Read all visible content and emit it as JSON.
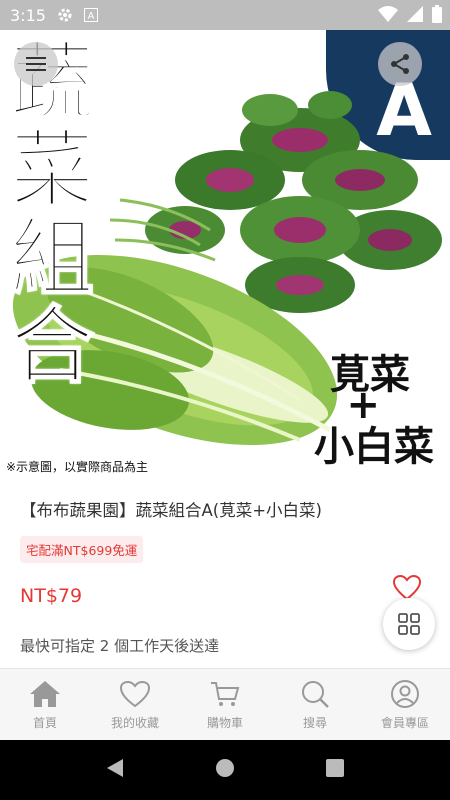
{
  "status": {
    "time": "3:15",
    "icons": [
      "gear-icon",
      "a-icon",
      "wifi-icon",
      "signal-icon",
      "battery-icon"
    ]
  },
  "product_image": {
    "title_chars": [
      "蔬",
      "菜",
      "組",
      "合"
    ],
    "badge": "A",
    "side_line1": "莧菜",
    "side_plus": "+",
    "side_line2": "小白菜",
    "disclaimer": "※示意圖，以實際商品為主"
  },
  "product": {
    "name": "【布布蔬果園】蔬菜組合A(莧菜+小白菜)",
    "shipping_tag": "宅配滿NT$699免運",
    "price": "NT$79",
    "delivery_note": "最快可指定 2 個工作天後送達"
  },
  "bottom_nav": {
    "items": [
      {
        "label": "首頁",
        "icon": "home-icon"
      },
      {
        "label": "我的收藏",
        "icon": "heart-icon"
      },
      {
        "label": "購物車",
        "icon": "cart-icon"
      },
      {
        "label": "搜尋",
        "icon": "search-icon"
      },
      {
        "label": "會員專區",
        "icon": "user-icon"
      }
    ]
  },
  "colors": {
    "accent_red": "#e53935",
    "badge_navy": "#163a5f",
    "nav_gray": "#999999"
  }
}
